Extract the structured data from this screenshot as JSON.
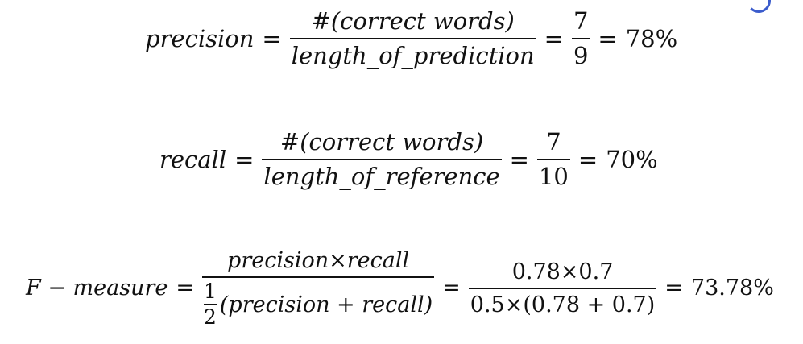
{
  "precision": {
    "lhs": "precision",
    "equals": "=",
    "numerator": "#(correct words)",
    "denominator": "length_of_prediction",
    "equals2": "=",
    "value_num": "7",
    "value_den": "9",
    "equals3": "=",
    "result": "78%"
  },
  "recall": {
    "lhs": "recall",
    "equals": "=",
    "numerator": "#(correct words)",
    "denominator": "length_of_reference",
    "equals2": "=",
    "value_num": "7",
    "value_den": "10",
    "equals3": "=",
    "result": "70%"
  },
  "fmeasure": {
    "lhs": "F − measure",
    "equals": "=",
    "numerator": "precision×recall",
    "half_num": "1",
    "half_den": "2",
    "denominator_rest": "(precision + recall)",
    "equals2": "=",
    "calc_num": "0.78×0.7",
    "calc_den": "0.5×(0.78 + 0.7)",
    "equals3": "=",
    "result": "73.78%"
  }
}
